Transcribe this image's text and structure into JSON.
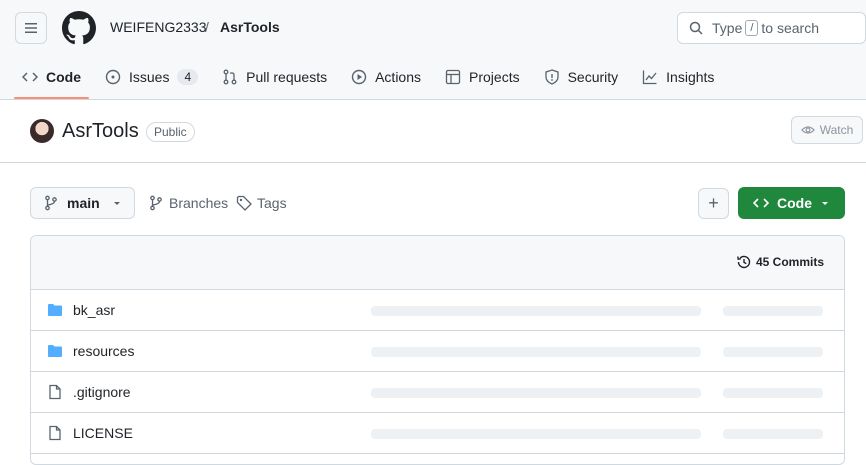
{
  "header": {
    "owner": "WEIFENG2333",
    "separator": "/",
    "repo": "AsrTools",
    "search": {
      "prefix": "Type",
      "key": "/",
      "suffix": "to search"
    }
  },
  "tabs": [
    {
      "label": "Code",
      "icon": "code-icon",
      "active": true
    },
    {
      "label": "Issues",
      "icon": "issue-icon",
      "count": "4"
    },
    {
      "label": "Pull requests",
      "icon": "pull-request-icon"
    },
    {
      "label": "Actions",
      "icon": "play-icon"
    },
    {
      "label": "Projects",
      "icon": "table-icon"
    },
    {
      "label": "Security",
      "icon": "shield-icon"
    },
    {
      "label": "Insights",
      "icon": "graph-icon"
    }
  ],
  "repo": {
    "name": "AsrTools",
    "visibility": "Public",
    "watch_label": "Watch"
  },
  "toolbar": {
    "branch": "main",
    "branches_label": "Branches",
    "tags_label": "Tags",
    "plus_label": "+",
    "code_label": "Code"
  },
  "files": {
    "commits": "45 Commits",
    "rows": [
      {
        "name": "bk_asr",
        "type": "folder"
      },
      {
        "name": "resources",
        "type": "folder"
      },
      {
        "name": ".gitignore",
        "type": "file"
      },
      {
        "name": "LICENSE",
        "type": "file"
      }
    ]
  },
  "colors": {
    "accent": "#fd8c73",
    "primary_button": "#1f883d",
    "folder": "#54aeff"
  }
}
